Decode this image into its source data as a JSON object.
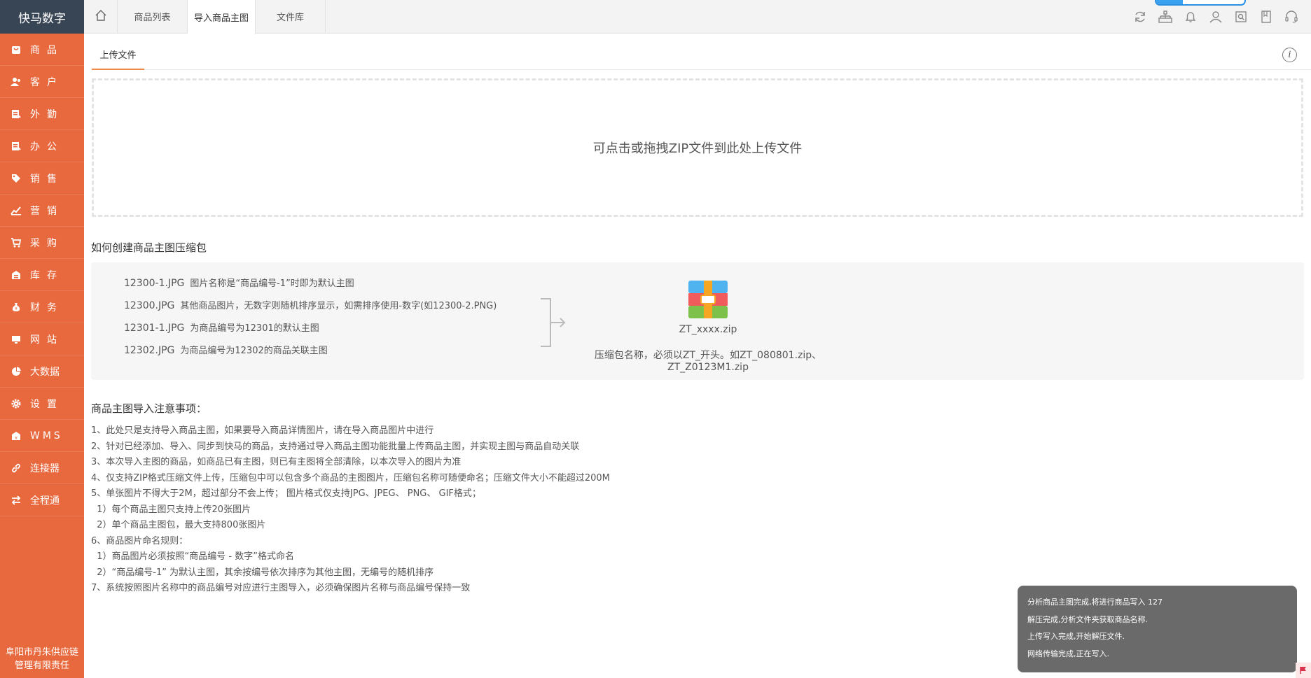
{
  "brand": "快马数字",
  "company": "阜阳市丹朱供应链管理有限责任",
  "sidebar": {
    "items": [
      {
        "label": "商品",
        "icon": "goods-icon"
      },
      {
        "label": "客户",
        "icon": "customer-icon"
      },
      {
        "label": "外勤",
        "icon": "field-icon"
      },
      {
        "label": "办公",
        "icon": "office-icon"
      },
      {
        "label": "销售",
        "icon": "tag-icon"
      },
      {
        "label": "营销",
        "icon": "chart-icon"
      },
      {
        "label": "采购",
        "icon": "cart-icon"
      },
      {
        "label": "库存",
        "icon": "warehouse-icon"
      },
      {
        "label": "财务",
        "icon": "money-bag-icon"
      },
      {
        "label": "网站",
        "icon": "monitor-icon"
      },
      {
        "label": "大数据",
        "icon": "pie-icon"
      },
      {
        "label": "设置",
        "icon": "gear-icon"
      },
      {
        "label": "WMS",
        "icon": "wms-icon"
      },
      {
        "label": "连接器",
        "icon": "link-icon"
      },
      {
        "label": "全程通",
        "icon": "transfer-icon"
      }
    ]
  },
  "tabs": [
    {
      "label": "商品列表"
    },
    {
      "label": "导入商品主图"
    },
    {
      "label": "文件库"
    }
  ],
  "top_progress": 0.3,
  "subtab": "上传文件",
  "dropzone_text": "可点击或拖拽ZIP文件到此处上传文件",
  "howto_title": "如何创建商品主图压缩包",
  "files": [
    {
      "name": "12300-1.JPG",
      "desc": "图片名称是“商品编号-1”时即为默认主图"
    },
    {
      "name": "12300.JPG",
      "desc": "其他商品图片，无数字则随机排序显示，如需排序使用-数字(如12300-2.PNG)"
    },
    {
      "name": "12301-1.JPG",
      "desc": "为商品编号为12301的默认主图"
    },
    {
      "name": "12302.JPG",
      "desc": "为商品编号为12302的商品关联主图"
    }
  ],
  "zip_name": "ZT_xxxx.zip",
  "zip_desc": "压缩包名称，必须以ZT_开头。如ZT_080801.zip、ZT_Z0123M1.zip",
  "notes_title": "商品主图导入注意事项：",
  "notes": [
    "1、此处只是支持导入商品主图，如果要导入商品详情图片，请在导入商品图片中进行",
    "2、针对已经添加、导入、同步到快马的商品，支持通过导入商品主图功能批量上传商品主图，并实现主图与商品自动关联",
    "3、本次导入主图的商品，如商品已有主图，则已有主图将全部清除，以本次导入的图片为准",
    "4、仅支持ZIP格式压缩文件上传，压缩包中可以包含多个商品的主图图片，压缩包名称可随便命名；压缩文件大小不能超过200M",
    "5、单张图片不得大于2M，超过部分不会上传； 图片格式仅支持JPG、JPEG、 PNG、 GIF格式；",
    "  1）每个商品主图只支持上传20张图片",
    "  2）单个商品主图包，最大支持800张图片",
    "6、商品图片命名规则：",
    "  1）商品图片必须按照“商品编号 - 数字”格式命名",
    "  2）“商品编号-1” 为默认主图，其余按编号依次排序为其他主图，无编号的随机排序",
    "7、系统按照图片名称中的商品编号对应进行主图导入，必须确保图片名称与商品编号保持一致"
  ],
  "toast": [
    "分析商品主图完成,将进行商品写入 127",
    "解压完成,分析文件夹获取商品名称.",
    "上传写入完成,开始解压文件.",
    "网络传输完成,正在写入."
  ],
  "colors": {
    "sidebar": "#e8693e",
    "brand_bg": "#384554",
    "accent": "#f08a4b",
    "toast_bg": "#6a6a6a"
  }
}
